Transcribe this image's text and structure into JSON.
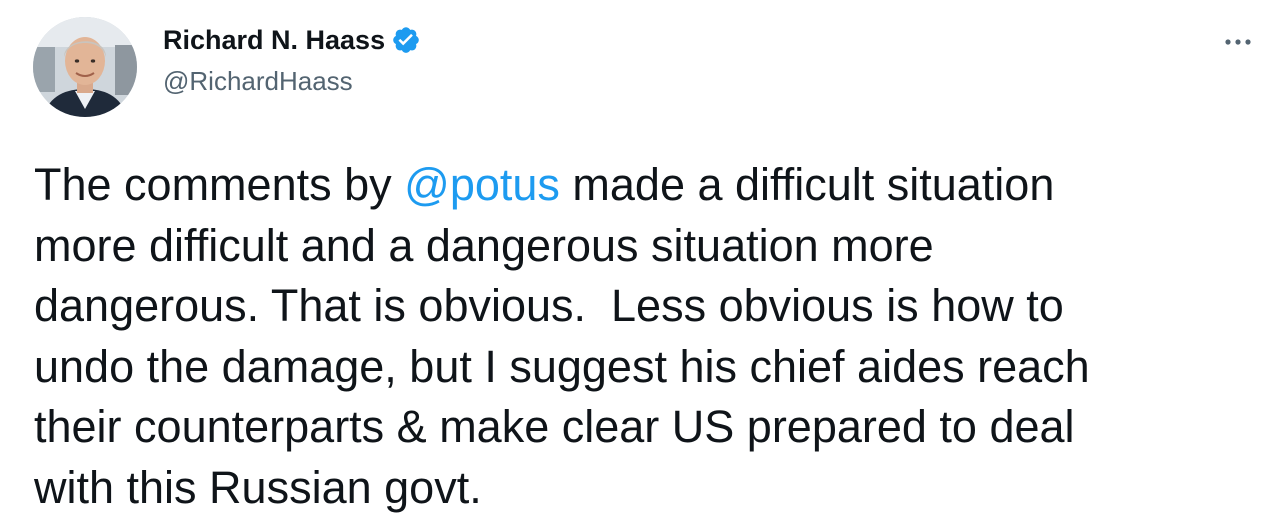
{
  "author": {
    "display_name": "Richard N. Haass",
    "handle": "@RichardHaass",
    "verified": true,
    "avatar_icon": "profile-photo"
  },
  "menu": {
    "icon": "more-options-icon"
  },
  "tweet": {
    "lines": [
      {
        "before": "The comments by ",
        "mention": "@potus",
        "after": " made a difficult situation"
      },
      {
        "text": "more difficult and a dangerous situation more"
      },
      {
        "text": "dangerous. That is obvious.  Less obvious is how to"
      },
      {
        "text": "undo the damage, but I suggest his chief aides reach"
      },
      {
        "text": "their counterparts & make clear US prepared to deal"
      },
      {
        "text": "with this Russian govt."
      }
    ]
  },
  "colors": {
    "text": "#0f1419",
    "secondary": "#536471",
    "accent": "#1d9bf0"
  }
}
